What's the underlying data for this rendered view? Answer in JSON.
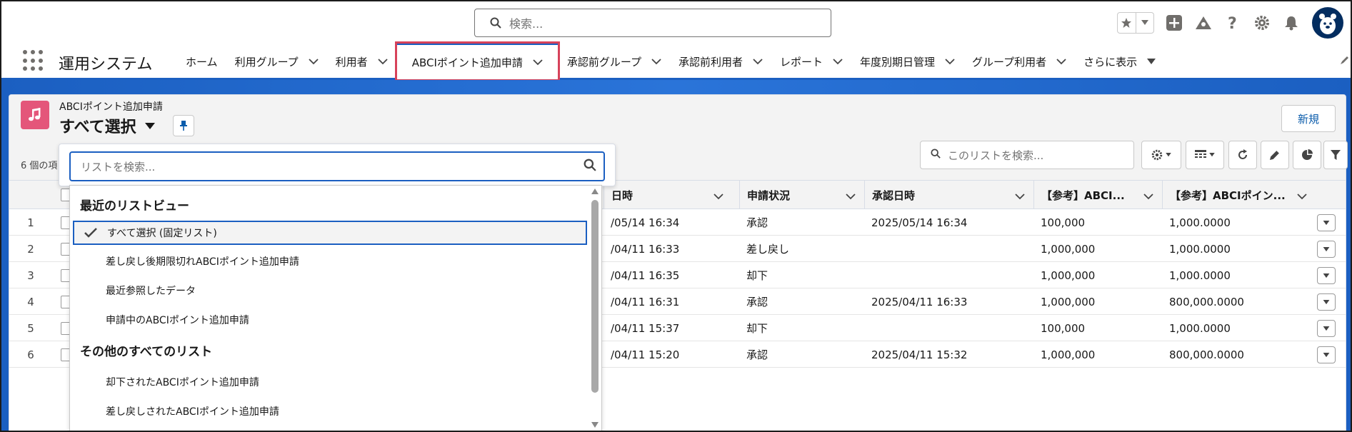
{
  "header": {
    "search_placeholder": "検索...",
    "icons": [
      "star-icon",
      "add-icon",
      "trailhead-icon",
      "help-icon",
      "gear-icon",
      "bell-icon",
      "avatar-icon"
    ]
  },
  "nav": {
    "app_name": "運用システム",
    "items": [
      {
        "label": "ホーム",
        "chevron": false
      },
      {
        "label": "利用グループ",
        "chevron": true
      },
      {
        "label": "利用者",
        "chevron": true
      },
      {
        "label": "ABCIポイント追加申請",
        "chevron": true,
        "active": true
      },
      {
        "label": "承認前グループ",
        "chevron": true
      },
      {
        "label": "承認前利用者",
        "chevron": true
      },
      {
        "label": "レポート",
        "chevron": true
      },
      {
        "label": "年度別期日管理",
        "chevron": true
      },
      {
        "label": "グループ利用者",
        "chevron": true
      }
    ],
    "more_label": "さらに表示"
  },
  "list_header": {
    "object_label": "ABCIポイント追加申請",
    "view_name": "すべて選択",
    "new_button": "新規",
    "item_count": "6 個の項",
    "list_search_placeholder": "このリストを検索..."
  },
  "table": {
    "columns": [
      "日時",
      "申請状況",
      "承認日時",
      "【参考】ABCI...",
      "【参考】ABCIポイン..."
    ],
    "rows": [
      {
        "num": "1",
        "date": "/05/14 16:34",
        "status": "承認",
        "approved": "2025/05/14 16:34",
        "ref1": "100,000",
        "ref2": "1,000.0000"
      },
      {
        "num": "2",
        "date": "/04/11 16:33",
        "status": "差し戻し",
        "approved": "",
        "ref1": "1,000,000",
        "ref2": "1,000.0000"
      },
      {
        "num": "3",
        "date": "/04/11 16:35",
        "status": "却下",
        "approved": "",
        "ref1": "1,000,000",
        "ref2": "1,000.0000"
      },
      {
        "num": "4",
        "date": "/04/11 16:31",
        "status": "承認",
        "approved": "2025/04/11 16:33",
        "ref1": "1,000,000",
        "ref2": "800,000.0000"
      },
      {
        "num": "5",
        "date": "/04/11 15:37",
        "status": "却下",
        "approved": "",
        "ref1": "100,000",
        "ref2": "1,000.0000"
      },
      {
        "num": "6",
        "date": "/04/11 15:20",
        "status": "承認",
        "approved": "2025/04/11 15:32",
        "ref1": "1,000,000",
        "ref2": "800,000.0000"
      }
    ]
  },
  "dropdown": {
    "search_placeholder": "リストを検索...",
    "recent_heading": "最近のリストビュー",
    "recent": [
      "すべて選択 (固定リスト)",
      "差し戻し後期限切れABCIポイント追加申請",
      "最近参照したデータ",
      "申請中のABCIポイント追加申請"
    ],
    "other_heading": "その他のすべてのリスト",
    "other": [
      "却下されたABCIポイント追加申請",
      "差し戻しされたABCIポイント追加申請"
    ]
  },
  "colors": {
    "brand": "#1b5fc1",
    "highlight": "#d7425a",
    "object_icon": "#e4567a"
  }
}
